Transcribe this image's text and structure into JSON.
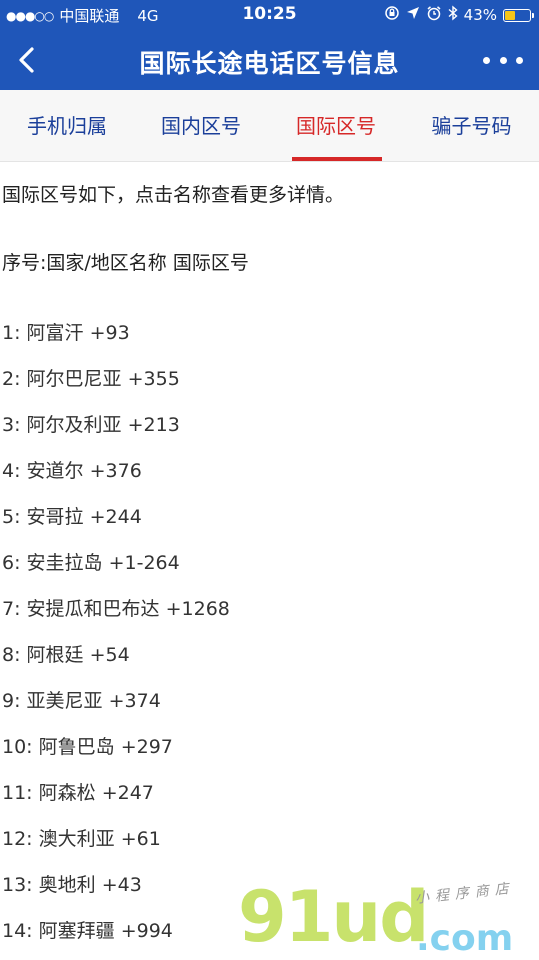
{
  "status_bar": {
    "signal": "●●●○○",
    "carrier": "中国联通",
    "network": "4G",
    "time": "10:25",
    "battery_percent": "43%",
    "battery_level": 0.43,
    "battery_color": "#f5c518"
  },
  "nav": {
    "title": "国际长途电话区号信息",
    "back_icon": "chevron-left-icon",
    "more_icon": "more-dots-icon",
    "bar_color": "#1f56b9"
  },
  "tabs": [
    {
      "label": "手机归属",
      "active": false
    },
    {
      "label": "国内区号",
      "active": false
    },
    {
      "label": "国际区号",
      "active": true
    },
    {
      "label": "骗子号码",
      "active": false
    }
  ],
  "content": {
    "intro": "国际区号如下，点击名称查看更多详情。",
    "header": "序号:国家/地区名称 国际区号",
    "countries": [
      {
        "index": "1:",
        "name": "阿富汗",
        "code": "+93"
      },
      {
        "index": "2:",
        "name": "阿尔巴尼亚",
        "code": "+355"
      },
      {
        "index": "3:",
        "name": "阿尔及利亚",
        "code": "+213"
      },
      {
        "index": "4:",
        "name": "安道尔",
        "code": "+376"
      },
      {
        "index": "5:",
        "name": "安哥拉",
        "code": "+244"
      },
      {
        "index": "6:",
        "name": "安圭拉岛",
        "code": "+1-264"
      },
      {
        "index": "7:",
        "name": "安提瓜和巴布达",
        "code": "+1268"
      },
      {
        "index": "8:",
        "name": "阿根廷",
        "code": "+54"
      },
      {
        "index": "9:",
        "name": "亚美尼亚",
        "code": "+374"
      },
      {
        "index": "10:",
        "name": "阿鲁巴岛",
        "code": "+297"
      },
      {
        "index": "11:",
        "name": "阿森松",
        "code": "+247"
      },
      {
        "index": "12:",
        "name": "澳大利亚",
        "code": "+61"
      },
      {
        "index": "13:",
        "name": "奥地利",
        "code": "+43"
      },
      {
        "index": "14:",
        "name": "阿塞拜疆",
        "code": "+994"
      }
    ]
  },
  "watermark": {
    "logo": "91ud",
    "tld": ".com",
    "tagline": "小程序商店"
  },
  "colors": {
    "active_tab": "#d62828",
    "inactive_tab": "#1b3f9a"
  }
}
